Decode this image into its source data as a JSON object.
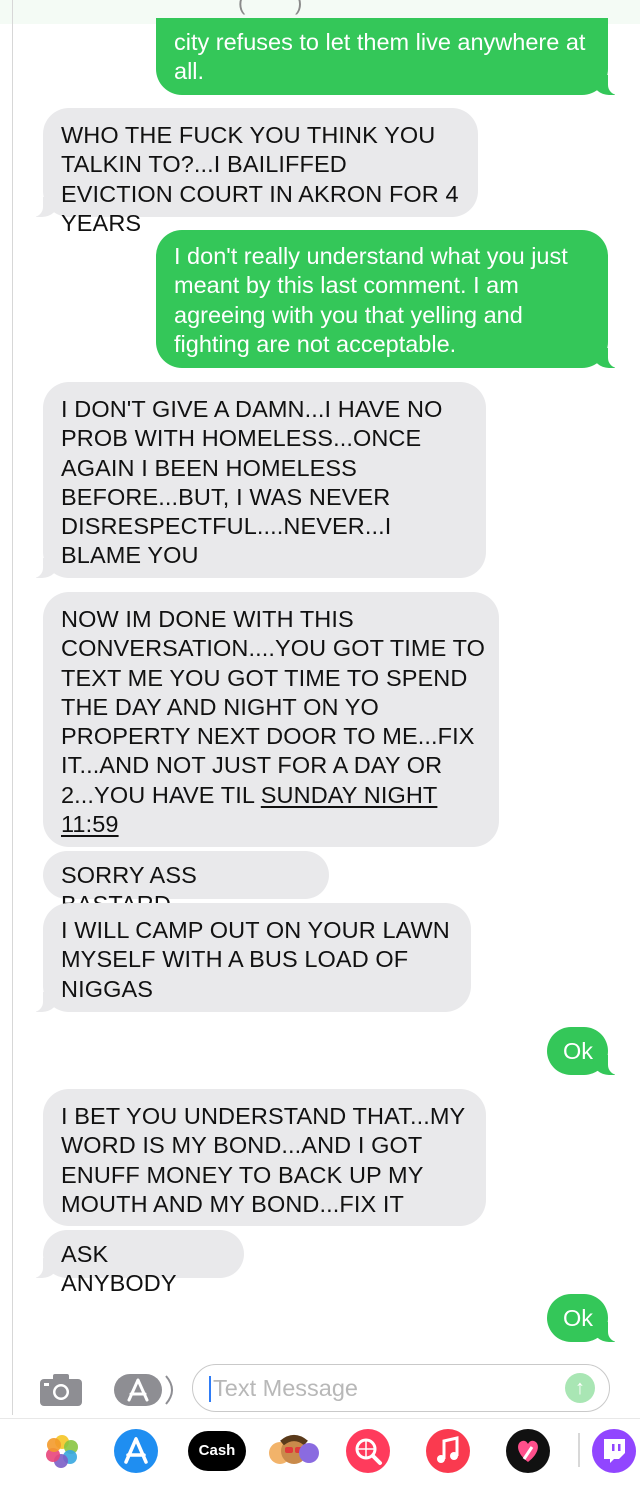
{
  "messages": [
    {
      "from": "me",
      "text": "city refuses to let them live anywhere at all."
    },
    {
      "from": "them",
      "text": "WHO THE FUCK YOU THINK YOU TALKIN TO?...I BAILIFFED EVICTION COURT IN AKRON FOR 4 YEARS"
    },
    {
      "from": "me",
      "text": "I don't really understand what you just meant by this last comment. I am agreeing with you that yelling and fighting are not acceptable."
    },
    {
      "from": "them",
      "text": "I DON'T GIVE A DAMN...I HAVE NO PROB WITH HOMELESS...ONCE AGAIN I BEEN HOMELESS BEFORE...BUT, I WAS NEVER DISRESPECTFUL....NEVER...I BLAME YOU"
    },
    {
      "from": "them",
      "text": "NOW IM DONE WITH THIS CONVERSATION....YOU GOT TIME TO TEXT ME YOU GOT TIME TO SPEND THE DAY AND NIGHT ON YO PROPERTY NEXT DOOR TO ME...FIX IT...AND NOT JUST FOR A DAY OR 2...YOU HAVE TIL ",
      "link": "SUNDAY NIGHT 11:59"
    },
    {
      "from": "them",
      "text": "SORRY ASS BASTARD"
    },
    {
      "from": "them",
      "text": "I WILL CAMP OUT ON YOUR LAWN MYSELF WITH A BUS LOAD OF NIGGAS"
    },
    {
      "from": "me",
      "text": "Ok"
    },
    {
      "from": "them",
      "text": "I BET YOU UNDERSTAND THAT...MY WORD IS MY BOND...AND I GOT ENUFF MONEY TO BACK UP MY MOUTH AND MY BOND...FIX IT"
    },
    {
      "from": "them",
      "text": "ASK ANYBODY"
    },
    {
      "from": "me",
      "text": "Ok"
    }
  ],
  "composer": {
    "placeholder": "Text Message",
    "camera_icon": "camera-icon",
    "appstore_icon": "app-store-icon",
    "send_icon": "send-arrow-icon"
  },
  "app_drawer": [
    {
      "name": "photos-icon",
      "color": "#f5a623"
    },
    {
      "name": "app-store-icon",
      "color": "#1f8ef1"
    },
    {
      "name": "cash-app-icon",
      "label": "Cash",
      "color": "#000000"
    },
    {
      "name": "memoji-icon",
      "color": "#6a5acd"
    },
    {
      "name": "web-search-icon",
      "color": "#ff3b5c"
    },
    {
      "name": "music-icon",
      "color": "#fa3a4f"
    },
    {
      "name": "digital-touch-icon",
      "color": "#111111"
    },
    {
      "name": "twitch-icon",
      "color": "#9146ff"
    }
  ],
  "colors": {
    "sent": "#34c759",
    "received": "#e9e9eb"
  }
}
